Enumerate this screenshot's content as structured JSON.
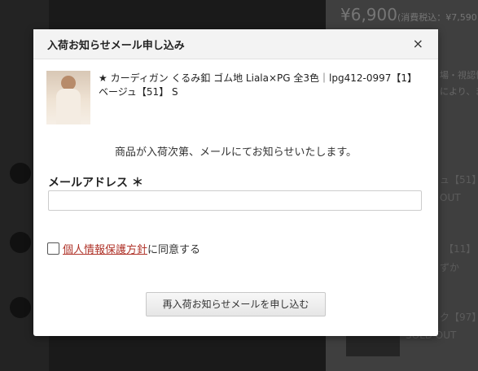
{
  "background": {
    "price": "¥6,900",
    "price_note": "(消費税込：¥7,590",
    "note_1": "場・視認性",
    "note_2": "により、ま",
    "items": [
      {
        "label": "ュ【51】"
      },
      {
        "label": "OUT"
      },
      {
        "label": "【11】"
      },
      {
        "label": "ずか"
      },
      {
        "label": "ク【97】"
      },
      {
        "label": "SOLD OUT"
      }
    ]
  },
  "modal": {
    "title": "入荷お知らせメール申し込み",
    "close_icon": "close-icon",
    "product_name": "★ カーディガン くるみ釦 ゴム地 Liala×PG 全3色｜lpg412-0997【1】ベージュ【51】 S",
    "notice": "商品が入荷次第、メールにてお知らせいたします。",
    "email_label": "メールアドレス ＊",
    "email_value": "",
    "agree_link": "個人情報保護方針",
    "agree_suffix": "に同意する",
    "submit_label": "再入荷お知らせメールを申し込む"
  }
}
